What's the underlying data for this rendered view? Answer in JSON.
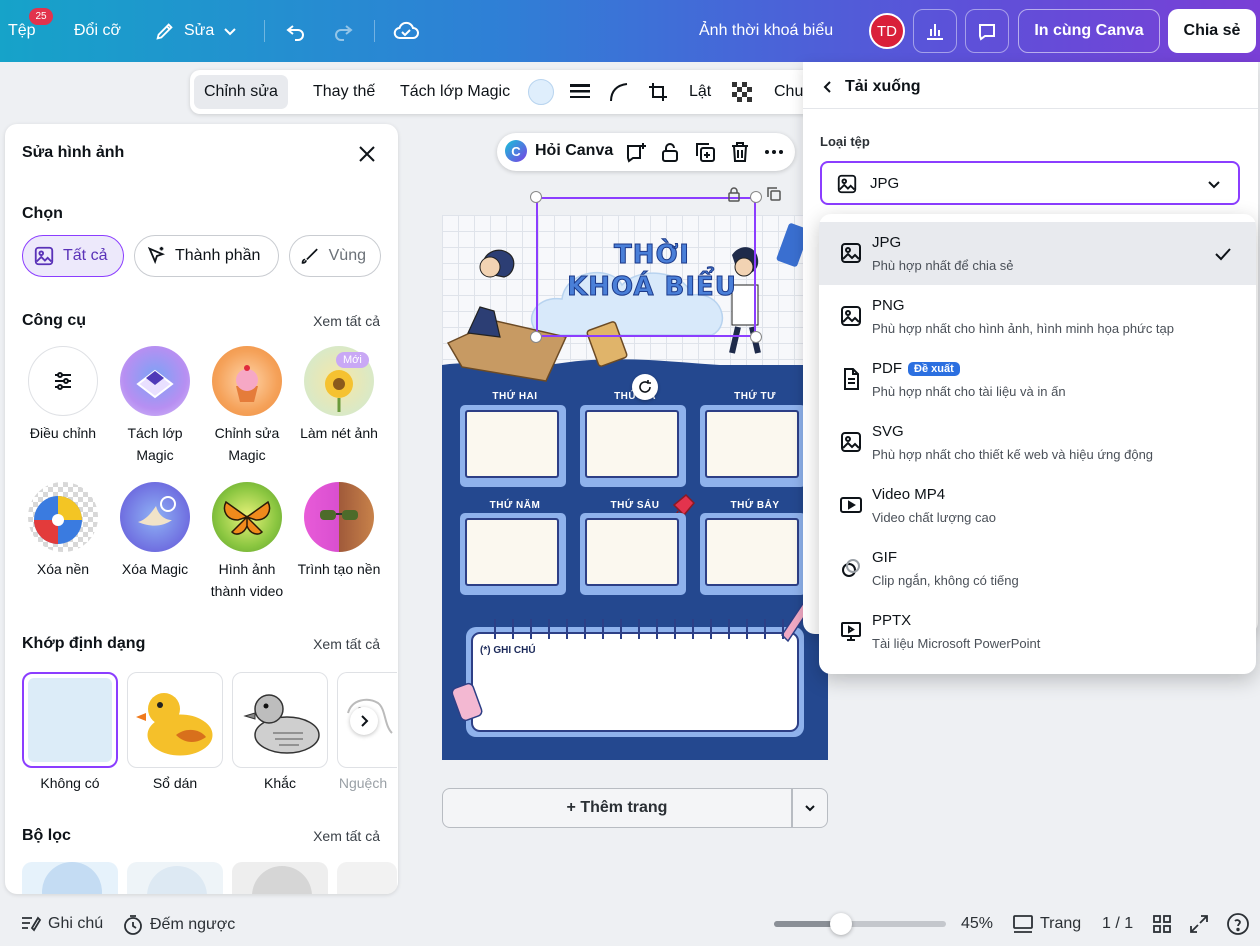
{
  "topbar": {
    "file": "Tệp",
    "notif_count": "25",
    "resize": "Đổi cỡ",
    "edit": "Sửa",
    "doc_title": "Ảnh thời khoá biểu",
    "avatar": "TD",
    "print": "In cùng Canva",
    "share": "Chia sẻ"
  },
  "ctx_toolbar": {
    "edit": "Chỉnh sửa",
    "replace": "Thay thế",
    "bg_remover": "Tách lớp Magic",
    "flip": "Lật",
    "more": "Chu"
  },
  "left_panel": {
    "title": "Sửa hình ảnh",
    "select_title": "Chọn",
    "chips": [
      "Tất cả",
      "Thành phần",
      "Vùng"
    ],
    "tools_title": "Công cụ",
    "see_all": "Xem tất cả",
    "new_badge": "Mới",
    "tools": [
      {
        "label": "Điều chỉnh",
        "icon": "sliders-icon"
      },
      {
        "label": "Tách lớp Magic",
        "icon": "magic-grab-icon"
      },
      {
        "label": "Chỉnh sửa Magic",
        "icon": "magic-edit-icon"
      },
      {
        "label": "Làm nét ảnh",
        "icon": "enhance-icon"
      },
      {
        "label": "Xóa nền",
        "icon": "bg-remove-icon"
      },
      {
        "label": "Xóa Magic",
        "icon": "magic-eraser-icon"
      },
      {
        "label": "Hình ảnh thành video",
        "icon": "image-to-video-icon"
      },
      {
        "label": "Trình tạo nền",
        "icon": "bg-generator-icon"
      }
    ],
    "match_title": "Khớp định dạng",
    "styles": [
      "Không có",
      "Sổ dán",
      "Khắc",
      "Nguệch"
    ],
    "filter_title": "Bộ lọc"
  },
  "canvas": {
    "ask_canva": "Hỏi Canva",
    "heading_line1": "THỜI",
    "heading_line2": "KHOÁ BIỂU",
    "days": [
      "THỨ HAI",
      "THỨ BA",
      "THỨ TƯ",
      "THỨ NĂM",
      "THỨ SÁU",
      "THỨ BẢY"
    ],
    "note_label": "(*) GHI CHÚ",
    "add_page": "+ Thêm trang"
  },
  "download": {
    "back_title": "Tải xuống",
    "file_type_label": "Loại tệp",
    "selected": "JPG",
    "options": [
      {
        "name": "JPG",
        "desc": "Phù hợp nhất để chia sẻ",
        "icon": "image-icon",
        "selected": true
      },
      {
        "name": "PNG",
        "desc": "Phù hợp nhất cho hình ảnh, hình minh họa phức tạp",
        "icon": "image-icon"
      },
      {
        "name": "PDF",
        "desc": "Phù hợp nhất cho tài liệu và in ấn",
        "icon": "document-icon",
        "badge": "Đề xuất"
      },
      {
        "name": "SVG",
        "desc": "Phù hợp nhất cho thiết kế web và hiệu ứng động",
        "icon": "image-icon"
      },
      {
        "name": "Video MP4",
        "desc": "Video chất lượng cao",
        "icon": "video-icon"
      },
      {
        "name": "GIF",
        "desc": "Clip ngắn, không có tiếng",
        "icon": "gif-icon"
      },
      {
        "name": "PPTX",
        "desc": "Tài liệu Microsoft PowerPoint",
        "icon": "presentation-icon"
      }
    ]
  },
  "bottom": {
    "notes": "Ghi chú",
    "timer": "Đếm ngược",
    "zoom": "45%",
    "pages": "Trang",
    "page_count": "1 / 1"
  }
}
